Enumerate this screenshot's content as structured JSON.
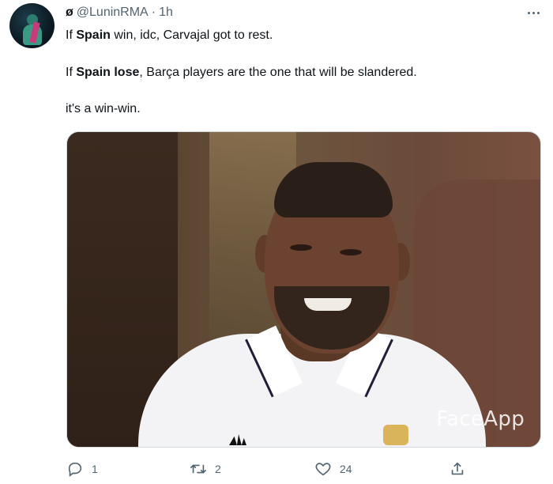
{
  "header": {
    "display_name": "ø",
    "handle": "@LuninRMA",
    "dot": "·",
    "time": "1h"
  },
  "tweet": {
    "line1_prefix": "If ",
    "line1_bold": "Spain",
    "line1_suffix": " win, idc, Carvajal got to rest.",
    "line2_prefix": "If ",
    "line2_bold": "Spain lose",
    "line2_suffix": ", Barça players are the one that will be slandered.",
    "line3": "it's a win-win."
  },
  "media": {
    "watermark": "FaceApp"
  },
  "actions": {
    "reply_count": "1",
    "retweet_count": "2",
    "like_count": "24"
  },
  "icons": {
    "more": "more-icon",
    "reply": "reply-icon",
    "retweet": "retweet-icon",
    "like": "heart-icon",
    "share": "share-icon"
  },
  "colors": {
    "text": "#0f1419",
    "secondary": "#536471"
  }
}
